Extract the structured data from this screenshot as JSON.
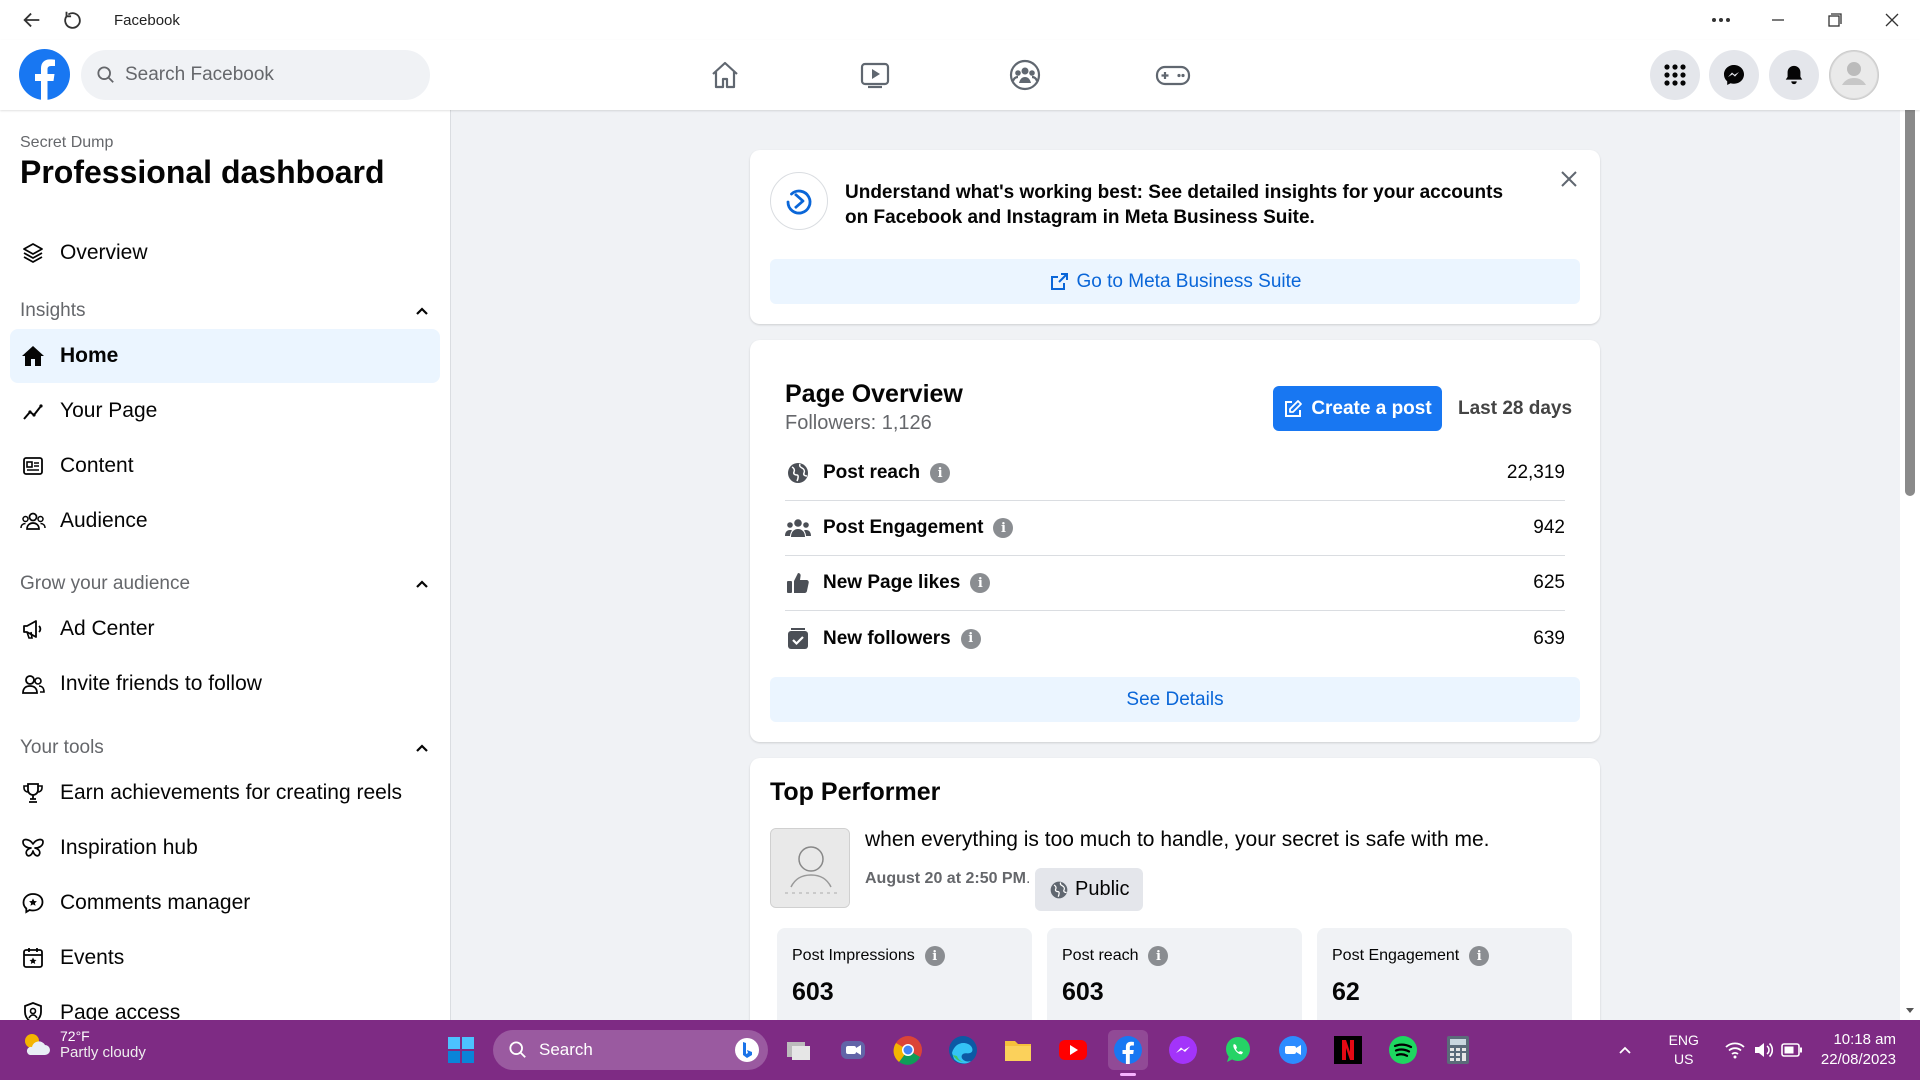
{
  "window": {
    "title": "Facebook"
  },
  "header": {
    "search_placeholder": "Search Facebook"
  },
  "sidebar": {
    "subtitle": "Secret Dump",
    "title": "Professional dashboard",
    "overview": "Overview",
    "sections": {
      "insights": "Insights",
      "grow": "Grow your audience",
      "tools": "Your tools"
    },
    "insights_items": [
      "Home",
      "Your Page",
      "Content",
      "Audience"
    ],
    "grow_items": [
      "Ad Center",
      "Invite friends to follow"
    ],
    "tools_items": [
      "Earn achievements for creating reels",
      "Inspiration hub",
      "Comments manager",
      "Events",
      "Page access"
    ]
  },
  "banner": {
    "text": "Understand what's working best: See detailed insights for your accounts on Facebook and Instagram in Meta Business Suite.",
    "link": "Go to Meta Business Suite"
  },
  "overview": {
    "title": "Page Overview",
    "followers": "Followers: 1,126",
    "create_post": "Create a post",
    "range": "Last 28 days",
    "metrics": [
      {
        "label": "Post reach",
        "value": "22,319"
      },
      {
        "label": "Post Engagement",
        "value": "942"
      },
      {
        "label": "New Page likes",
        "value": "625"
      },
      {
        "label": "New followers",
        "value": "639"
      }
    ],
    "see_details": "See Details"
  },
  "top_performer": {
    "title": "Top Performer",
    "post_text": "when everything is too much to handle, your secret is safe with me.",
    "date": "August 20 at 2:50 PM",
    "separator": ".",
    "audience": "Public",
    "stats": [
      {
        "label": "Post Impressions",
        "value": "603"
      },
      {
        "label": "Post reach",
        "value": "603"
      },
      {
        "label": "Post Engagement",
        "value": "62"
      }
    ]
  },
  "taskbar": {
    "temp": "72°F",
    "weather": "Partly cloudy",
    "search": "Search",
    "lang1": "ENG",
    "lang2": "US",
    "time": "10:18 am",
    "date": "22/08/2023"
  },
  "colors": {
    "brand": "#1877f2",
    "taskbar": "#7e2b84",
    "active_item": "#ebf5ff"
  }
}
